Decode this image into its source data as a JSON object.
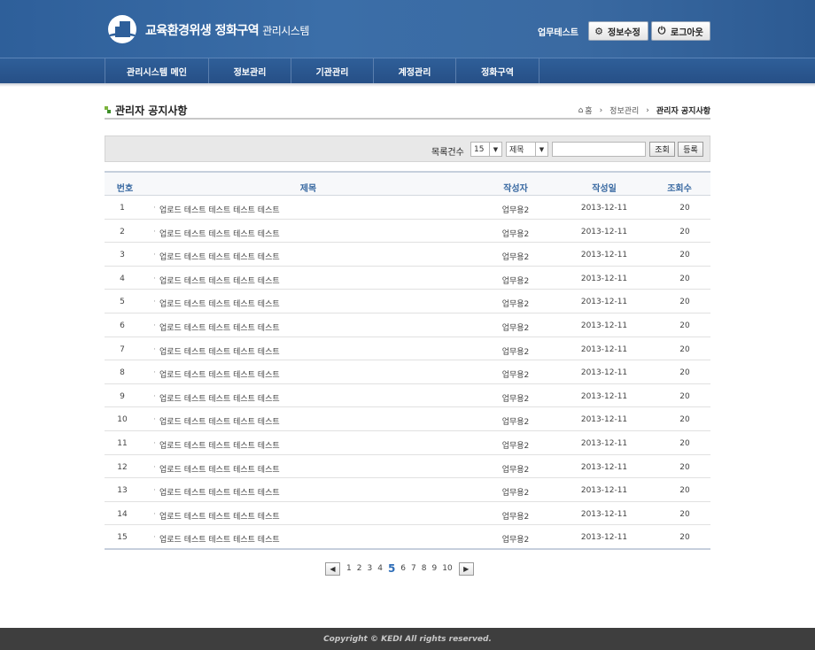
{
  "header": {
    "title_main": "교육환경위생 정화구역",
    "title_sub": "관리시스템",
    "user_name": "업무테스트",
    "info_edit_label": "정보수정",
    "logout_label": "로그아웃"
  },
  "nav": {
    "items": [
      {
        "label": "관리시스템 메인"
      },
      {
        "label": "정보관리"
      },
      {
        "label": "기관관리"
      },
      {
        "label": "계정관리"
      },
      {
        "label": "정화구역"
      }
    ]
  },
  "page": {
    "title": "관리자 공지사항",
    "breadcrumb": [
      "홈",
      "정보관리",
      "관리자 공지사항"
    ]
  },
  "search": {
    "count_label": "목록건수",
    "count_value": "15",
    "field_value": "제목",
    "query": "",
    "search_label": "조회",
    "register_label": "등록"
  },
  "table": {
    "headers": [
      "번호",
      "제목",
      "작성자",
      "작성일",
      "조회수"
    ],
    "rows": [
      {
        "no": "1",
        "title": "업로드 테스트 테스트 테스트 테스트",
        "author": "업무용2",
        "date": "2013-12-11",
        "views": "20"
      },
      {
        "no": "2",
        "title": "업로드 테스트 테스트 테스트 테스트",
        "author": "업무용2",
        "date": "2013-12-11",
        "views": "20"
      },
      {
        "no": "3",
        "title": "업로드 테스트 테스트 테스트 테스트",
        "author": "업무용2",
        "date": "2013-12-11",
        "views": "20"
      },
      {
        "no": "4",
        "title": "업로드 테스트 테스트 테스트 테스트",
        "author": "업무용2",
        "date": "2013-12-11",
        "views": "20"
      },
      {
        "no": "5",
        "title": "업로드 테스트 테스트 테스트 테스트",
        "author": "업무용2",
        "date": "2013-12-11",
        "views": "20"
      },
      {
        "no": "6",
        "title": "업로드 테스트 테스트 테스트 테스트",
        "author": "업무용2",
        "date": "2013-12-11",
        "views": "20"
      },
      {
        "no": "7",
        "title": "업로드 테스트 테스트 테스트 테스트",
        "author": "업무용2",
        "date": "2013-12-11",
        "views": "20"
      },
      {
        "no": "8",
        "title": "업로드 테스트 테스트 테스트 테스트",
        "author": "업무용2",
        "date": "2013-12-11",
        "views": "20"
      },
      {
        "no": "9",
        "title": "업로드 테스트 테스트 테스트 테스트",
        "author": "업무용2",
        "date": "2013-12-11",
        "views": "20"
      },
      {
        "no": "10",
        "title": "업로드 테스트 테스트 테스트 테스트",
        "author": "업무용2",
        "date": "2013-12-11",
        "views": "20"
      },
      {
        "no": "11",
        "title": "업로드 테스트 테스트 테스트 테스트",
        "author": "업무용2",
        "date": "2013-12-11",
        "views": "20"
      },
      {
        "no": "12",
        "title": "업로드 테스트 테스트 테스트 테스트",
        "author": "업무용2",
        "date": "2013-12-11",
        "views": "20"
      },
      {
        "no": "13",
        "title": "업로드 테스트 테스트 테스트 테스트",
        "author": "업무용2",
        "date": "2013-12-11",
        "views": "20"
      },
      {
        "no": "14",
        "title": "업로드 테스트 테스트 테스트 테스트",
        "author": "업무용2",
        "date": "2013-12-11",
        "views": "20"
      },
      {
        "no": "15",
        "title": "업로드 테스트 테스트 테스트 테스트",
        "author": "업무용2",
        "date": "2013-12-11",
        "views": "20"
      }
    ]
  },
  "pagination": {
    "pages": [
      "1",
      "2",
      "3",
      "4",
      "5",
      "6",
      "7",
      "8",
      "9",
      "10"
    ],
    "current": "5",
    "prev_icon": "prev-arrow-icon",
    "next_icon": "next-arrow-icon"
  },
  "footer": {
    "copyright": "Copyright © KEDI All rights reserved."
  },
  "colors": {
    "header_blue": "#3b6ea8",
    "nav_blue": "#2b5790",
    "table_header_text": "#3a6aa2",
    "footer_bg": "#3e3e3e"
  }
}
